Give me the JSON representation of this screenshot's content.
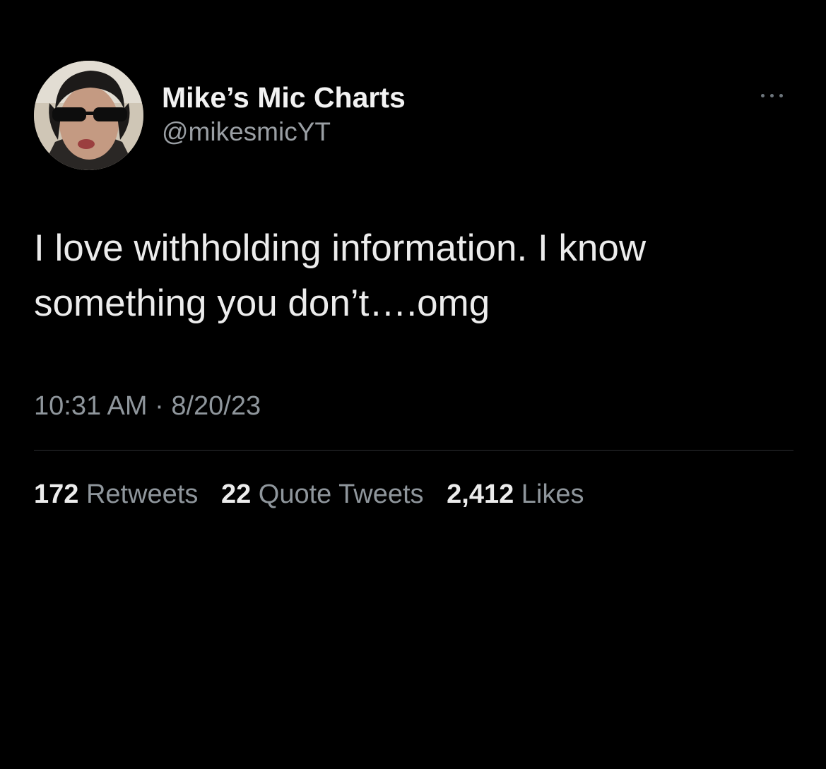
{
  "author": {
    "display_name": "Mike’s Mic Charts",
    "handle": "@mikesmicYT",
    "avatar_icon": "profile-photo"
  },
  "more_icon": "more-horizontal-icon",
  "tweet": {
    "text": "I love withholding information. I know\nsomething you don’t….omg",
    "time": "10:31 AM",
    "separator": "·",
    "date": "8/20/23"
  },
  "stats": {
    "retweets": {
      "count": "172",
      "label": "Retweets"
    },
    "quote_tweets": {
      "count": "22",
      "label": "Quote Tweets"
    },
    "likes": {
      "count": "2,412",
      "label": "Likes"
    }
  },
  "colors": {
    "background": "#000000",
    "primary_text": "#e7e9ea",
    "secondary_text": "#8f969c",
    "divider": "#2c2f32"
  }
}
